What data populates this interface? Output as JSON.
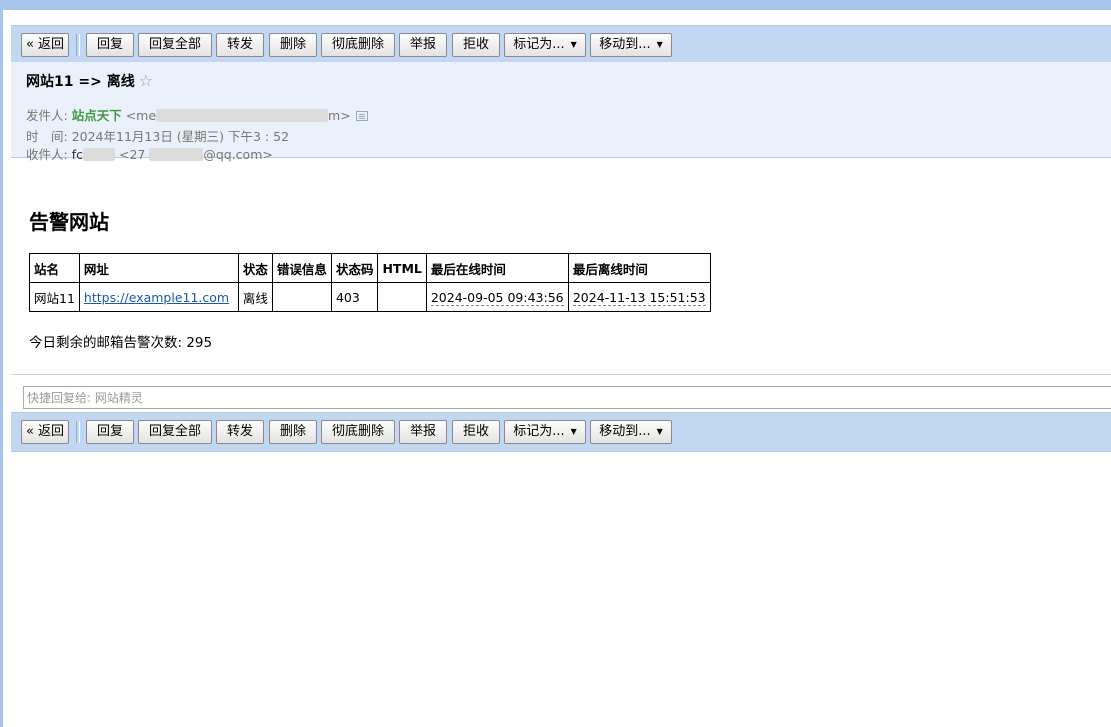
{
  "toolbar": {
    "back": "« 返回",
    "reply": "回复",
    "reply_all": "回复全部",
    "forward": "转发",
    "delete": "删除",
    "delete_permanently": "彻底删除",
    "report": "举报",
    "reject": "拒收",
    "mark_as": "标记为...",
    "move_to": "移动到..."
  },
  "header": {
    "subject": "网站11 => 离线",
    "star": "☆",
    "sender_label": "发件人:",
    "sender_name": "站点天下",
    "sender_email_start": "<me",
    "sender_email_end": "m>",
    "time_label": "时　间:",
    "time_value": "2024年11月13日 (星期三) 下午3 : 52",
    "recipient_label": "收件人:",
    "recipient_name_start": "fc",
    "recipient_email_start": "<27",
    "recipient_email_end": "@qq.com>"
  },
  "body": {
    "title": "告警网站",
    "table": {
      "headers": [
        "站名",
        "网址",
        "状态",
        "错误信息",
        "状态码",
        "HTML",
        "最后在线时间",
        "最后离线时间"
      ],
      "rows": [
        {
          "name": "网站11",
          "url": "https://example11.com",
          "status": "离线",
          "error": "",
          "code": "403",
          "html": "",
          "last_online": "2024-09-05 09:43:56",
          "last_offline": "2024-11-13 15:51:53"
        }
      ]
    },
    "remaining_text": "今日剩余的邮箱告警次数: 295"
  },
  "quick_reply": {
    "placeholder": "快捷回复给: 网站精灵"
  }
}
